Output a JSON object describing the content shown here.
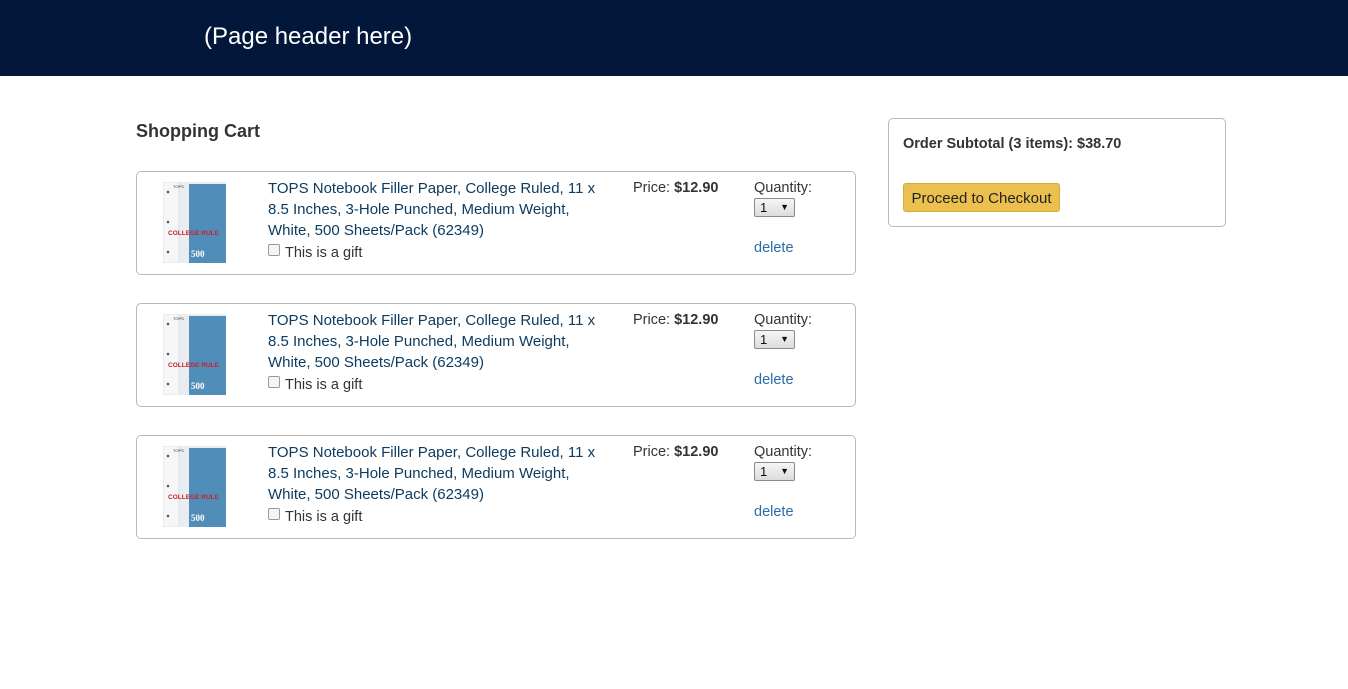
{
  "header": {
    "title": "(Page header here)"
  },
  "cart": {
    "title": "Shopping Cart",
    "items": [
      {
        "title": "TOPS Notebook Filler Paper, College Ruled, 11 x 8.5 Inches, 3-Hole Punched, Medium Weight, White, 500 Sheets/Pack (62349)",
        "gift_label": "This is a gift",
        "gift_checked": false,
        "price_label": "Price:",
        "price": "$12.90",
        "quantity_label": "Quantity:",
        "quantity": "1",
        "delete_label": "delete",
        "thumb": {
          "brand": "TOPS",
          "line1": "COLLEGE RULE",
          "count": "500"
        }
      },
      {
        "title": "TOPS Notebook Filler Paper, College Ruled, 11 x 8.5 Inches, 3-Hole Punched, Medium Weight, White, 500 Sheets/Pack (62349)",
        "gift_label": "This is a gift",
        "gift_checked": false,
        "price_label": "Price:",
        "price": "$12.90",
        "quantity_label": "Quantity:",
        "quantity": "1",
        "delete_label": "delete",
        "thumb": {
          "brand": "TOPS",
          "line1": "COLLEGE RULE",
          "count": "500"
        }
      },
      {
        "title": "TOPS Notebook Filler Paper, College Ruled, 11 x 8.5 Inches, 3-Hole Punched, Medium Weight, White, 500 Sheets/Pack (62349)",
        "gift_label": "This is a gift",
        "gift_checked": false,
        "price_label": "Price:",
        "price": "$12.90",
        "quantity_label": "Quantity:",
        "quantity": "1",
        "delete_label": "delete",
        "thumb": {
          "brand": "TOPS",
          "line1": "COLLEGE RULE",
          "count": "500"
        }
      }
    ]
  },
  "summary": {
    "subtotal": "Order Subtotal (3 items): $38.70",
    "checkout_label": "Proceed to Checkout"
  },
  "icons": {
    "quantity_dropdown": "chevron-down-icon",
    "gift": "checkbox-icon"
  },
  "colors": {
    "header_bg": "#03173a",
    "link": "#0c3a5d",
    "delete_link": "#2a6ba8",
    "checkout_button": "#ecc04e"
  }
}
